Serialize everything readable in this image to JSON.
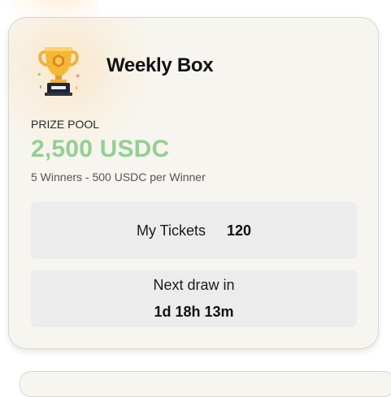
{
  "card": {
    "title": "Weekly Box",
    "trophy_icon": "trophy-icon",
    "prize_pool": {
      "label": "PRIZE POOL",
      "amount": "2,500 USDC",
      "amount_color": "#94cf93",
      "details": "5 Winners - 500 USDC per Winner"
    },
    "tickets": {
      "label": "My Tickets",
      "value": "120"
    },
    "next_draw": {
      "label": "Next draw in",
      "countdown": "1d 18h 13m"
    }
  }
}
